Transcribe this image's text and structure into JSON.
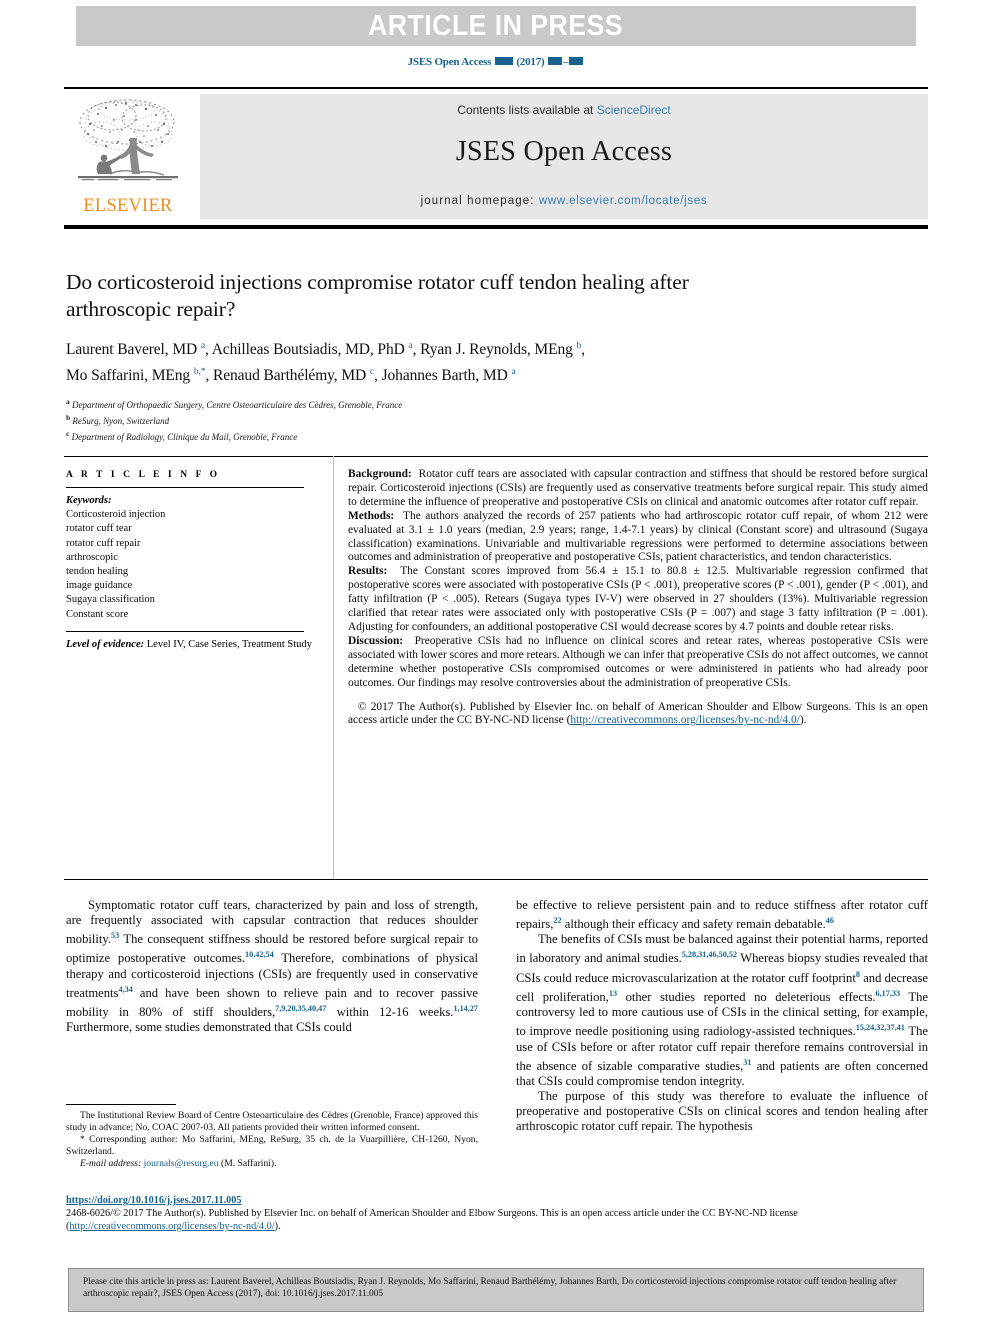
{
  "banner": {
    "label": "ARTICLE IN PRESS"
  },
  "running_head": {
    "journal": "JSES Open Access",
    "year": "(2017)",
    "volume_placeholder": "■■",
    "pages_placeholder": "■■–■■"
  },
  "masthead": {
    "contents_prefix": "Contents lists available at ",
    "sciencedirect": "ScienceDirect",
    "journal_title": "JSES Open Access",
    "homepage_label": "journal homepage: ",
    "homepage_url": "www.elsevier.com/locate/jses",
    "publisher_logo_word": "ELSEVIER"
  },
  "article": {
    "title": "Do corticosteroid injections compromise rotator cuff tendon healing after arthroscopic repair?",
    "authors_line1": "Laurent Baverel, MD a, Achilleas Boutsiadis, MD, PhD a, Ryan J. Reynolds, MEng b,",
    "authors_line2": "Mo Saffarini, MEng b,*, Renaud Barthélémy, MD c, Johannes Barth, MD a",
    "affiliations": [
      {
        "marker": "a",
        "text": "Department of Orthopaedic Surgery, Centre Osteoarticulaire des Cèdres, Grenoble, France"
      },
      {
        "marker": "b",
        "text": "ReSurg, Nyon, Switzerland"
      },
      {
        "marker": "c",
        "text": "Department of Radiology, Clinique du Mail, Grenoble, France"
      }
    ]
  },
  "article_info": {
    "heading": "A R T I C L E   I N F O",
    "keywords_label": "Keywords:",
    "keywords": [
      "Corticosteroid injection",
      "rotator cuff tear",
      "rotator cuff repair",
      "arthroscopic",
      "tendon healing",
      "image guidance",
      "Sugaya classification",
      "Constant score"
    ],
    "level_of_evidence_label": "Level of evidence:",
    "level_of_evidence_value": "Level IV, Case Series, Treatment Study"
  },
  "abstract": {
    "background_label": "Background:",
    "background_text": "Rotator cuff tears are associated with capsular contraction and stiffness that should be restored before surgical repair. Corticosteroid injections (CSIs) are frequently used as conservative treatments before surgical repair. This study aimed to determine the influence of preoperative and postoperative CSIs on clinical and anatomic outcomes after rotator cuff repair.",
    "methods_label": "Methods:",
    "methods_text": "The authors analyzed the records of 257 patients who had arthroscopic rotator cuff repair, of whom 212 were evaluated at 3.1 ± 1.0 years (median, 2.9 years; range, 1.4-7.1 years) by clinical (Constant score) and ultrasound (Sugaya classification) examinations. Univariable and multivariable regressions were performed to determine associations between outcomes and administration of preoperative and postoperative CSIs, patient characteristics, and tendon characteristics.",
    "results_label": "Results:",
    "results_text": "The Constant scores improved from 56.4 ± 15.1 to 80.8 ± 12.5. Multivariable regression confirmed that postoperative scores were associated with postoperative CSIs (P < .001), preoperative scores (P < .001), gender (P < .001), and fatty infiltration (P < .005). Retears (Sugaya types IV-V) were observed in 27 shoulders (13%). Multivariable regression clarified that retear rates were associated only with postoperative CSIs (P = .007) and stage 3 fatty infiltration (P = .001). Adjusting for confounders, an additional postoperative CSI would decrease scores by 4.7 points and double retear risks.",
    "discussion_label": "Discussion:",
    "discussion_text": "Preoperative CSIs had no influence on clinical scores and retear rates, whereas postoperative CSIs were associated with lower scores and more retears. Although we can infer that preoperative CSIs do not affect outcomes, we cannot determine whether postoperative CSIs compromised outcomes or were administered in patients who had already poor outcomes. Our findings may resolve controversies about the administration of preoperative CSIs.",
    "copyright_line": "© 2017 The Author(s). Published by Elsevier Inc. on behalf of American Shoulder and Elbow Surgeons.",
    "license_prefix": "This is an open access article under the CC BY-NC-ND license (",
    "license_url": "http://creativecommons.org/licenses/by-nc-nd/4.0/",
    "license_suffix": ")."
  },
  "body": {
    "left_paragraphs": [
      {
        "segments": [
          {
            "t": "Symptomatic rotator cuff tears, characterized by pain and loss of strength, are frequently associated with capsular contraction that reduces shoulder mobility."
          },
          {
            "t": "53",
            "ref": true
          },
          {
            "t": " The consequent stiffness should be restored before surgical repair to optimize postoperative outcomes."
          },
          {
            "t": "10,42,54",
            "ref": true
          },
          {
            "t": " Therefore, combinations of physical therapy and corticosteroid injections (CSIs) are frequently used in conservative treatments"
          },
          {
            "t": "4,34",
            "ref": true
          },
          {
            "t": " and have been shown to relieve pain and to recover passive mobility in 80% of stiff shoulders,"
          },
          {
            "t": "7,9,20,35,40,47",
            "ref": true
          },
          {
            "t": " within 12-16 weeks."
          },
          {
            "t": "1,14,27",
            "ref": true
          },
          {
            "t": " Furthermore, some studies demonstrated that CSIs could"
          }
        ]
      }
    ],
    "right_paragraphs": [
      {
        "noindent": true,
        "segments": [
          {
            "t": "be effective to relieve persistent pain and to reduce stiffness after rotator cuff repairs,"
          },
          {
            "t": "22",
            "ref": true
          },
          {
            "t": " although their efficacy and safety remain debatable."
          },
          {
            "t": "46",
            "ref": true
          }
        ]
      },
      {
        "segments": [
          {
            "t": "The benefits of CSIs must be balanced against their potential harms, reported in laboratory and animal studies."
          },
          {
            "t": "5,28,31,46,50,52",
            "ref": true
          },
          {
            "t": " Whereas biopsy studies revealed that CSIs could reduce microvascularization at the rotator cuff footprint"
          },
          {
            "t": "8",
            "ref": true
          },
          {
            "t": " and decrease cell proliferation,"
          },
          {
            "t": "13",
            "ref": true
          },
          {
            "t": " other studies reported no deleterious effects."
          },
          {
            "t": "6,17,33",
            "ref": true
          },
          {
            "t": " The controversy led to more cautious use of CSIs in the clinical setting, for example, to improve needle positioning using radiology-assisted techniques."
          },
          {
            "t": "15,24,32,37,41",
            "ref": true
          },
          {
            "t": " The use of CSIs before or after rotator cuff repair therefore remains controversial in the absence of sizable comparative studies,"
          },
          {
            "t": "31",
            "ref": true
          },
          {
            "t": " and patients are often concerned that CSIs could compromise tendon integrity."
          }
        ]
      },
      {
        "segments": [
          {
            "t": "The purpose of this study was therefore to evaluate the influence of preoperative and postoperative CSIs on clinical scores and tendon healing after arthroscopic rotator cuff repair. The hypothesis"
          }
        ]
      }
    ]
  },
  "footnotes": {
    "irb": "The Institutional Review Board of Centre Osteoarticulaire des Cèdres (Grenoble, France) approved this study in advance; No. COAC 2007-03. All patients provided their written informed consent.",
    "corresponding_marker": "*",
    "corresponding": "Corresponding author: Mo Saffarini, MEng, ReSurg, 35 ch. de la Vuarpillière, CH-1260, Nyon, Switzerland.",
    "email_label": "E-mail address:",
    "email": "journals@resurg.eu",
    "email_owner": "(M. Saffarini)."
  },
  "doi_block": {
    "doi_url": "https://doi.org/10.1016/j.jses.2017.11.005",
    "issn_copyright": "2468-6026/© 2017 The Author(s). Published by Elsevier Inc. on behalf of American Shoulder and Elbow Surgeons. This is an open access article under the CC BY-NC-ND license (",
    "license_url": "http://creativecommons.org/licenses/by-nc-nd/4.0/",
    "license_suffix": ")."
  },
  "citation_box": {
    "text": "Please cite this article in press as: Laurent Baverel, Achilleas Boutsiadis, Ryan J. Reynolds, Mo Saffarini, Renaud Barthélémy, Johannes Barth, Do corticosteroid injections compromise rotator cuff tendon healing after arthroscopic repair?, JSES Open Access (2017), doi: 10.1016/j.jses.2017.11.005"
  },
  "colors": {
    "link_blue": "#17628f",
    "sciencedirect_blue": "#3a7fb5",
    "elsevier_orange": "#f08a1d",
    "banner_gray": "#c9c9c9",
    "panel_gray": "#e7e7e8"
  }
}
